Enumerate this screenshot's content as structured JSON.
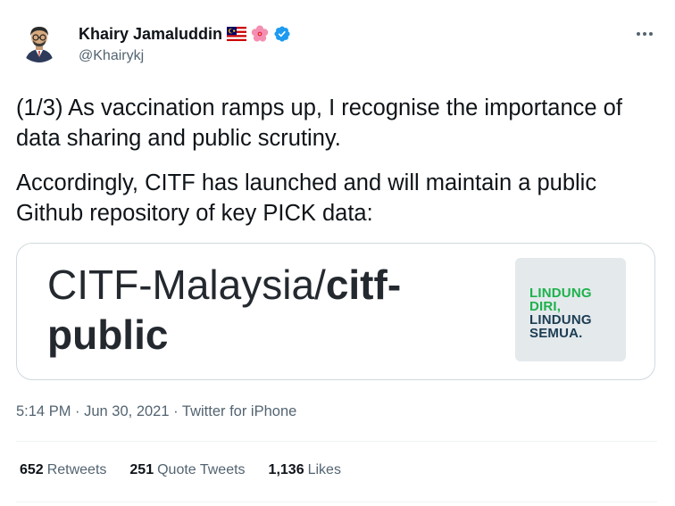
{
  "author": {
    "display_name": "Khairy Jamaluddin",
    "handle": "@Khairykj",
    "badges": [
      "malaysia-flag-icon",
      "hibiscus-icon",
      "verified-icon"
    ]
  },
  "tweet": {
    "paragraphs": [
      "(1/3) As vaccination ramps up, I recognise the importance of data sharing and public scrutiny.",
      "Accordingly, CITF has launched and will maintain a public Github repository of key PICK data:"
    ],
    "timestamp": "5:14 PM · Jun 30, 2021",
    "separator": " · ",
    "source": "Twitter for iPhone"
  },
  "card": {
    "owner": "CITF-Malaysia/",
    "repo": "citf-public",
    "image_lines": [
      "LINDUNG",
      "DIRI,",
      "LINDUNG",
      "SEMUA."
    ]
  },
  "stats": {
    "retweets_count": "652",
    "retweets_label": "Retweets",
    "quote_count": "251",
    "quote_label": "Quote Tweets",
    "likes_count": "1,136",
    "likes_label": "Likes"
  },
  "colors": {
    "text": "#0f1419",
    "secondary": "#536471",
    "verified": "#1d9bf0",
    "card_green": "#1db24c",
    "card_navy": "#1b3d53"
  }
}
